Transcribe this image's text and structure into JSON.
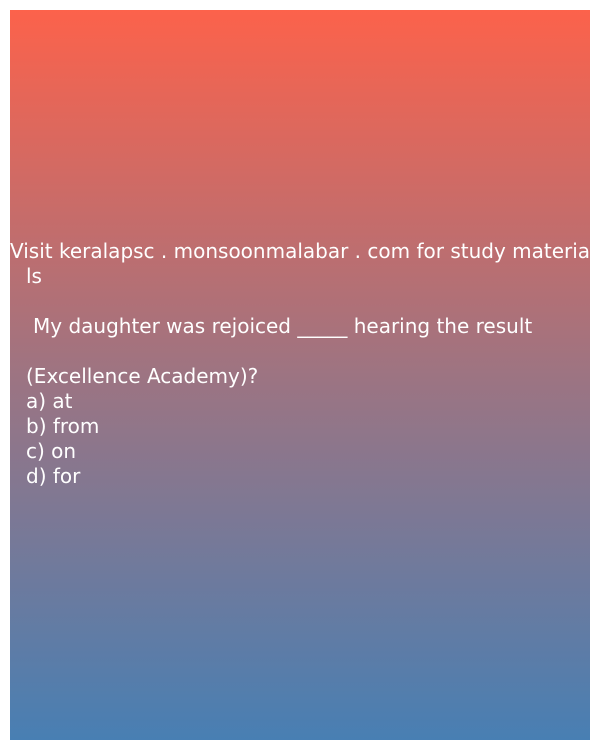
{
  "header": {
    "line1": "Visit keralapsc . monsoonmalabar . com for study materia",
    "line2": "ls"
  },
  "question": {
    "text": "My daughter was rejoiced _____ hearing the result",
    "source": "(Excellence Academy)?"
  },
  "options": [
    {
      "label": "a)",
      "text": "at"
    },
    {
      "label": "b)",
      "text": "from"
    },
    {
      "label": "c)",
      "text": "on"
    },
    {
      "label": "d)",
      "text": "for"
    }
  ],
  "colors": {
    "gradient_top": "#fc624b",
    "gradient_middle": "#9d7482",
    "gradient_bottom": "#487fb3",
    "text": "#ffffff"
  }
}
